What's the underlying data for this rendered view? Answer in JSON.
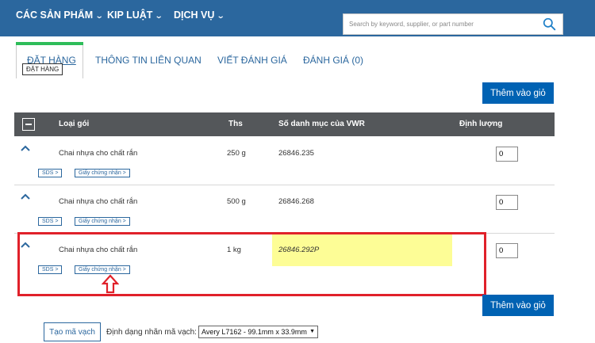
{
  "nav": {
    "items": [
      {
        "label": "CÁC SẢN PHẨM"
      },
      {
        "label": "KIP LUẬT"
      },
      {
        "label": "DỊCH VỤ"
      }
    ],
    "search_placeholder": "Search by keyword, supplier, or part number"
  },
  "tabs": {
    "active_label": "ĐẶT HÀNG",
    "tooltip": "ĐẶT HÀNG",
    "items": [
      "THÔNG TIN LIÊN QUAN",
      "VIẾT ĐÁNH GIÁ",
      "ĐÁNH GIÁ (0)"
    ]
  },
  "buttons": {
    "add_to_cart": "Thêm vào giỏ",
    "create_barcode": "Tạo mã vạch"
  },
  "table": {
    "headers": {
      "type": "Loại gói",
      "size": "Ths",
      "catalog": "Số danh mục của VWR",
      "quantity": "Định lượng"
    },
    "rows": [
      {
        "type": "Chai nhựa cho chất rắn",
        "size": "250 g",
        "catalog": "26846.235",
        "quantity": "0",
        "sds": "SDS",
        "cert": "Giấy chứng nhận"
      },
      {
        "type": "Chai nhựa cho chất rắn",
        "size": "500 g",
        "catalog": "26846.268",
        "quantity": "0",
        "sds": "SDS",
        "cert": "Giấy chứng nhận"
      },
      {
        "type": "Chai nhựa cho chất rắn",
        "size": "1 kg",
        "catalog": "26846.292P",
        "quantity": "0",
        "sds": "SDS",
        "cert": "Giấy chứng nhận"
      }
    ]
  },
  "barcode": {
    "label": "Định dạng nhãn mã vạch:",
    "selected": "Avery L7162 - 99.1mm x 33.9mm"
  },
  "colors": {
    "nav_bg": "#2b679e",
    "primary_button": "#0062b3",
    "tab_accent": "#2ebd59",
    "header_bg": "#54575a",
    "highlight": "#fdfd96",
    "annotation_red": "#e0212a"
  }
}
